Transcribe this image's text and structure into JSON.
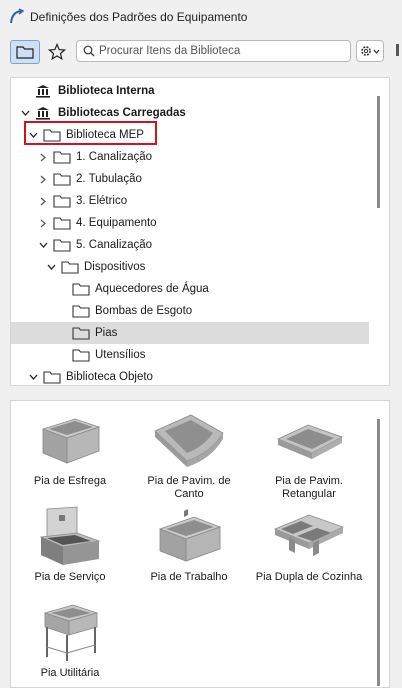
{
  "window": {
    "title": "Definições dos Padrões do Equipamento"
  },
  "toolbar": {
    "folder_view_icon": "folder-icon",
    "favorites_icon": "star-icon",
    "search_placeholder": "Procurar Itens da Biblioteca",
    "settings_icon": "gear-icon"
  },
  "tree": {
    "items": [
      {
        "label": "Biblioteca Interna",
        "bold": true,
        "icon": "library-icon"
      },
      {
        "label": "Bibliotecas Carregadas",
        "bold": true,
        "icon": "library-icon",
        "expanded": true
      },
      {
        "label": "Biblioteca MEP",
        "icon": "folder-icon",
        "expanded": true,
        "highlighted": true
      },
      {
        "label": "1. Canalização",
        "icon": "folder-icon"
      },
      {
        "label": "2. Tubulação",
        "icon": "folder-icon"
      },
      {
        "label": "3. Elétrico",
        "icon": "folder-icon"
      },
      {
        "label": "4. Equipamento",
        "icon": "folder-icon"
      },
      {
        "label": "5. Canalização",
        "icon": "folder-icon",
        "expanded": true
      },
      {
        "label": "Dispositivos",
        "icon": "folder-icon",
        "expanded": true
      },
      {
        "label": "Aquecedores de Água",
        "icon": "folder-icon"
      },
      {
        "label": "Bombas de Esgoto",
        "icon": "folder-icon"
      },
      {
        "label": "Pias",
        "icon": "folder-icon",
        "selected": true
      },
      {
        "label": "Utensílios",
        "icon": "folder-icon"
      },
      {
        "label": "Biblioteca Objeto",
        "icon": "folder-icon",
        "expanded": true
      }
    ]
  },
  "grid": {
    "items": [
      {
        "name": "Pia de Esfrega",
        "icon": "mop-sink-icon"
      },
      {
        "name": "Pia de Pavim. de Canto",
        "icon": "corner-floor-sink-icon"
      },
      {
        "name": "Pia de Pavim. Retangular",
        "icon": "rect-floor-sink-icon"
      },
      {
        "name": "Pia de Serviço",
        "icon": "service-sink-icon"
      },
      {
        "name": "Pia de Trabalho",
        "icon": "work-sink-icon"
      },
      {
        "name": "Pia Dupla de Cozinha",
        "icon": "double-kitchen-sink-icon"
      },
      {
        "name": "Pia Utilitária",
        "icon": "utility-sink-icon"
      }
    ]
  },
  "colors": {
    "highlight": "#d0141e",
    "selection": "#dcdcdc",
    "active_tab": "#cfe0f4"
  }
}
